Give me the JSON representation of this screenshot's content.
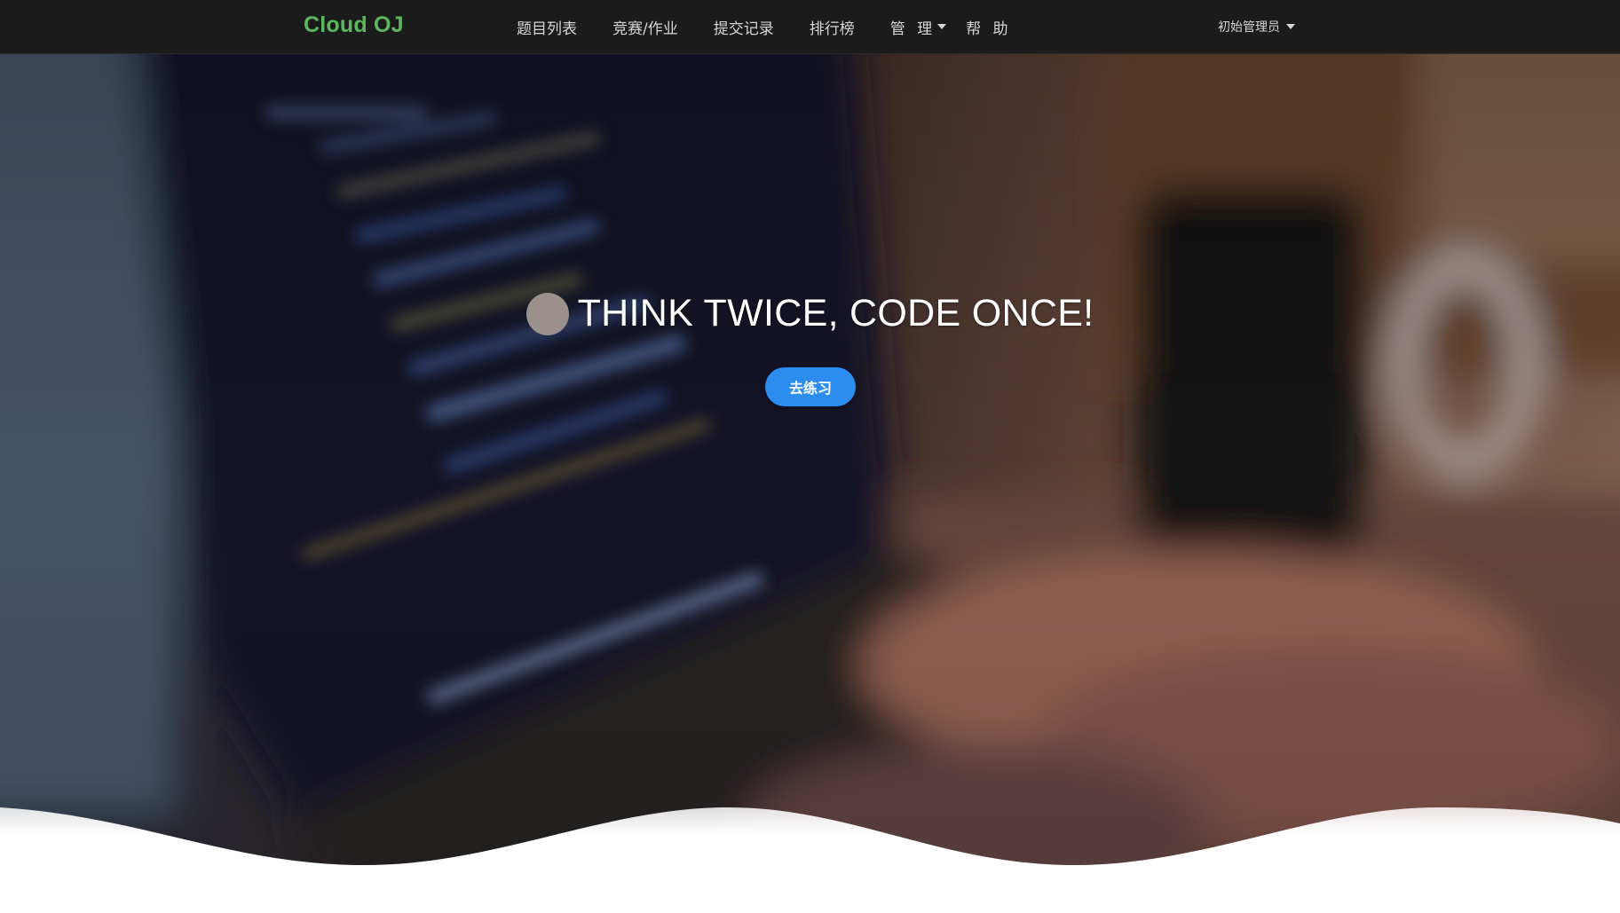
{
  "navbar": {
    "brand": "Cloud OJ",
    "items": [
      {
        "label": "题目列表"
      },
      {
        "label": "竞赛/作业"
      },
      {
        "label": "提交记录"
      },
      {
        "label": "排行榜"
      },
      {
        "label": "管 理"
      },
      {
        "label": "帮 助"
      }
    ],
    "user": "初始管理员"
  },
  "hero": {
    "title": "THINK TWICE, CODE ONCE!",
    "button_label": "去练习"
  },
  "colors": {
    "navbar_bg": "#1b1b1b",
    "brand": "#5cb85c",
    "button": "#2d8cf0"
  },
  "icons": {
    "manage_dropdown": "caret-down-icon",
    "user_dropdown": "caret-down-icon",
    "logo": "logo-icon"
  }
}
